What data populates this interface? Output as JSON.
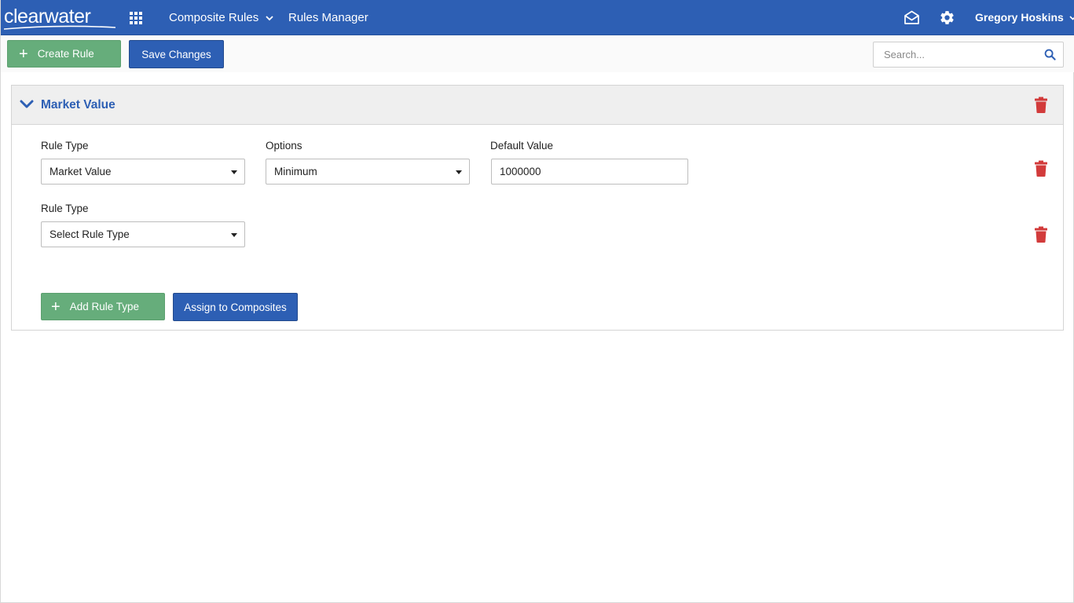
{
  "brand": {
    "logo_text": "clearwater"
  },
  "nav": {
    "composite_rules": "Composite Rules",
    "rules_manager": "Rules Manager",
    "user_name": "Gregory Hoskins"
  },
  "toolbar": {
    "create_rule_label": "Create Rule",
    "save_changes_label": "Save Changes",
    "search_placeholder": "Search..."
  },
  "panel": {
    "title": "Market Value",
    "rows": [
      {
        "rule_type_label": "Rule Type",
        "rule_type_value": "Market Value",
        "options_label": "Options",
        "options_value": "Minimum",
        "default_value_label": "Default Value",
        "default_value": "1000000"
      },
      {
        "rule_type_label": "Rule Type",
        "rule_type_value": "Select Rule Type"
      }
    ],
    "add_rule_type_label": "Add Rule Type",
    "assign_composites_label": "Assign to Composites"
  },
  "colors": {
    "primary_blue": "#2d5fb4",
    "action_green": "#66ad7b",
    "danger_red": "#d23b3b"
  },
  "icons": [
    "apps-grid-icon",
    "chevron-down-icon",
    "mail-icon",
    "gear-icon",
    "search-icon",
    "trash-icon",
    "collapse-chevron-icon",
    "plus-icon"
  ]
}
